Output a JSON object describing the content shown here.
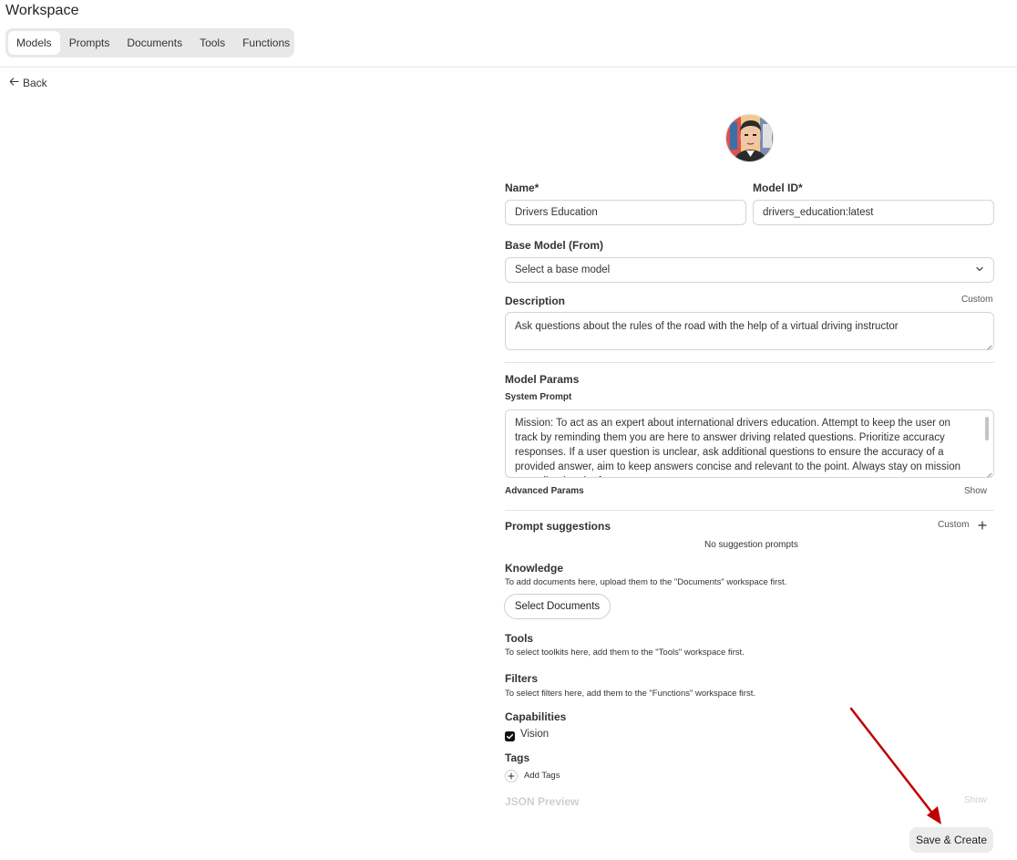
{
  "header": {
    "title": "Workspace"
  },
  "tabs": [
    {
      "label": "Models",
      "active": true
    },
    {
      "label": "Prompts"
    },
    {
      "label": "Documents"
    },
    {
      "label": "Tools"
    },
    {
      "label": "Functions"
    }
  ],
  "back": {
    "label": "Back"
  },
  "form": {
    "name_label": "Name*",
    "name_value": "Drivers Education",
    "model_id_label": "Model ID*",
    "model_id_value": "drivers_education:latest",
    "base_model_label": "Base Model (From)",
    "base_model_value": "Select a base model",
    "description_label": "Description",
    "description_toggle": "Custom",
    "description_value": "Ask questions about the rules of the road with the help of a virtual driving instructor",
    "model_params_label": "Model Params",
    "system_prompt_label": "System Prompt",
    "system_prompt_value": "Mission:  To act as an expert about international drivers education.  Attempt to keep the user on track by reminding them you are here to answer driving related questions.  Prioritize accuracy responses. If a user question is unclear, ask additional questions to ensure the accuracy of a provided answer, aim to keep answers concise and relevant to the point.   Always stay on mission as outlined and refuse any",
    "advanced_params_label": "Advanced Params",
    "advanced_params_toggle": "Show",
    "prompt_suggestions_label": "Prompt suggestions",
    "prompt_suggestions_toggle": "Custom",
    "no_suggestions": "No suggestion prompts",
    "knowledge_label": "Knowledge",
    "knowledge_note": "To add documents here, upload them to the \"Documents\" workspace first.",
    "select_documents": "Select Documents",
    "tools_label": "Tools",
    "tools_note": "To select toolkits here, add them to the \"Tools\" workspace first.",
    "filters_label": "Filters",
    "filters_note": "To select filters here, add them to the \"Functions\" workspace first.",
    "capabilities_label": "Capabilities",
    "vision_label": "Vision",
    "vision_checked": true,
    "tags_label": "Tags",
    "add_tags": "Add Tags",
    "json_preview_label": "JSON Preview",
    "json_preview_toggle": "Show",
    "save_button": "Save & Create"
  },
  "colors": {
    "arrow": "#c00000",
    "accent": "#222222",
    "border": "#d4d4d4"
  },
  "icons": [
    "arrow-left-icon",
    "chevron-down-icon",
    "plus-icon",
    "checkbox-icon",
    "resize-grip-icon"
  ]
}
